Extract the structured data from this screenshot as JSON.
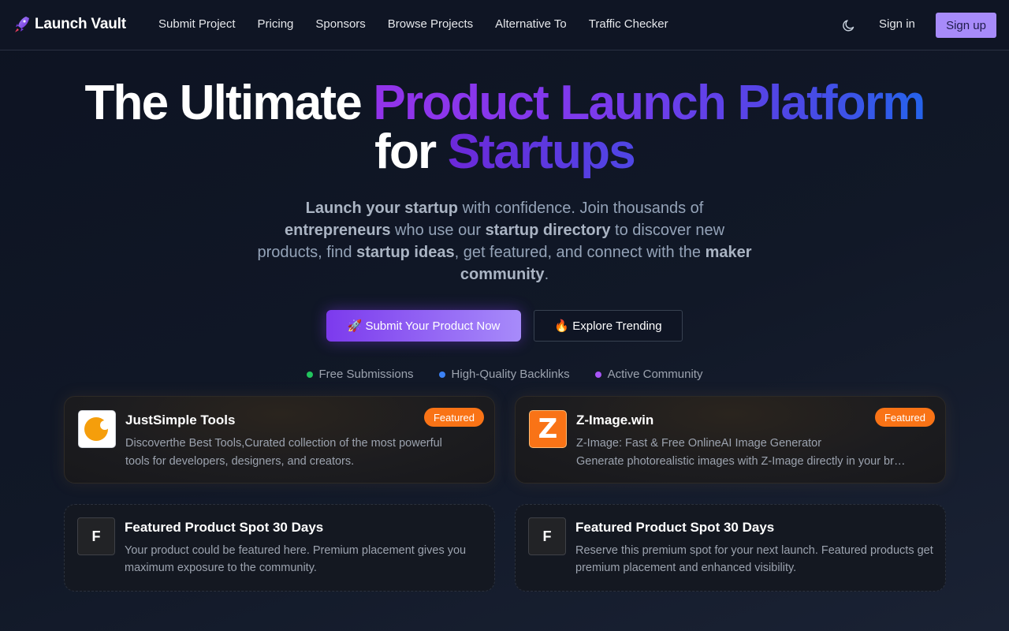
{
  "nav": {
    "brand": "Launch Vault",
    "links": [
      "Submit Project",
      "Pricing",
      "Sponsors",
      "Browse Projects",
      "Alternative To",
      "Traffic Checker"
    ],
    "theme_icon": "moon-icon",
    "signin": "Sign in",
    "signup": "Sign up"
  },
  "hero": {
    "title_part1": "The Ultimate ",
    "title_highlight": "Product Launch Platform",
    "title_part2": "for ",
    "title_highlight2": "Startups",
    "subtitle": {
      "b1": "Launch your startup",
      "t1": " with confidence. Join thousands of ",
      "b2": "entrepreneurs",
      "t2": " who use our ",
      "b3": "startup directory",
      "t3": " to discover new products, find ",
      "b4": "startup ideas",
      "t4": ", get featured, and connect with the ",
      "b5": "maker community",
      "t5": "."
    },
    "cta_primary": "🚀 Submit Your Product Now",
    "cta_secondary": "🔥 Explore Trending",
    "features": [
      {
        "label": "Free Submissions",
        "color": "#22c55e"
      },
      {
        "label": "High-Quality Backlinks",
        "color": "#3b82f6"
      },
      {
        "label": "Active Community",
        "color": "#a855f7"
      }
    ]
  },
  "featured": [
    {
      "name": "JustSimple Tools",
      "badge": "Featured",
      "desc_line1": "Discoverthe Best Tools,Curated collection of the most powerful",
      "desc_line2": "tools for developers, designers, and creators.",
      "logo_color": "#f59e0b"
    },
    {
      "name": "Z-Image.win",
      "badge": "Featured",
      "desc_line1": "Z-Image: Fast & Free OnlineAI Image Generator",
      "desc_line2": "Generate photorealistic images with Z-Image directly in your browser",
      "logo_color": "#f97316",
      "logo_letter": "Z"
    }
  ],
  "placeholders": [
    {
      "letter": "F",
      "title": "Featured Product Spot 30 Days",
      "desc": "Your product could be featured here. Premium placement gives you maximum exposure to the community."
    },
    {
      "letter": "F",
      "title": "Featured Product Spot 30 Days",
      "desc": "Reserve this premium spot for your next launch. Featured products get premium placement and enhanced visibility."
    }
  ]
}
